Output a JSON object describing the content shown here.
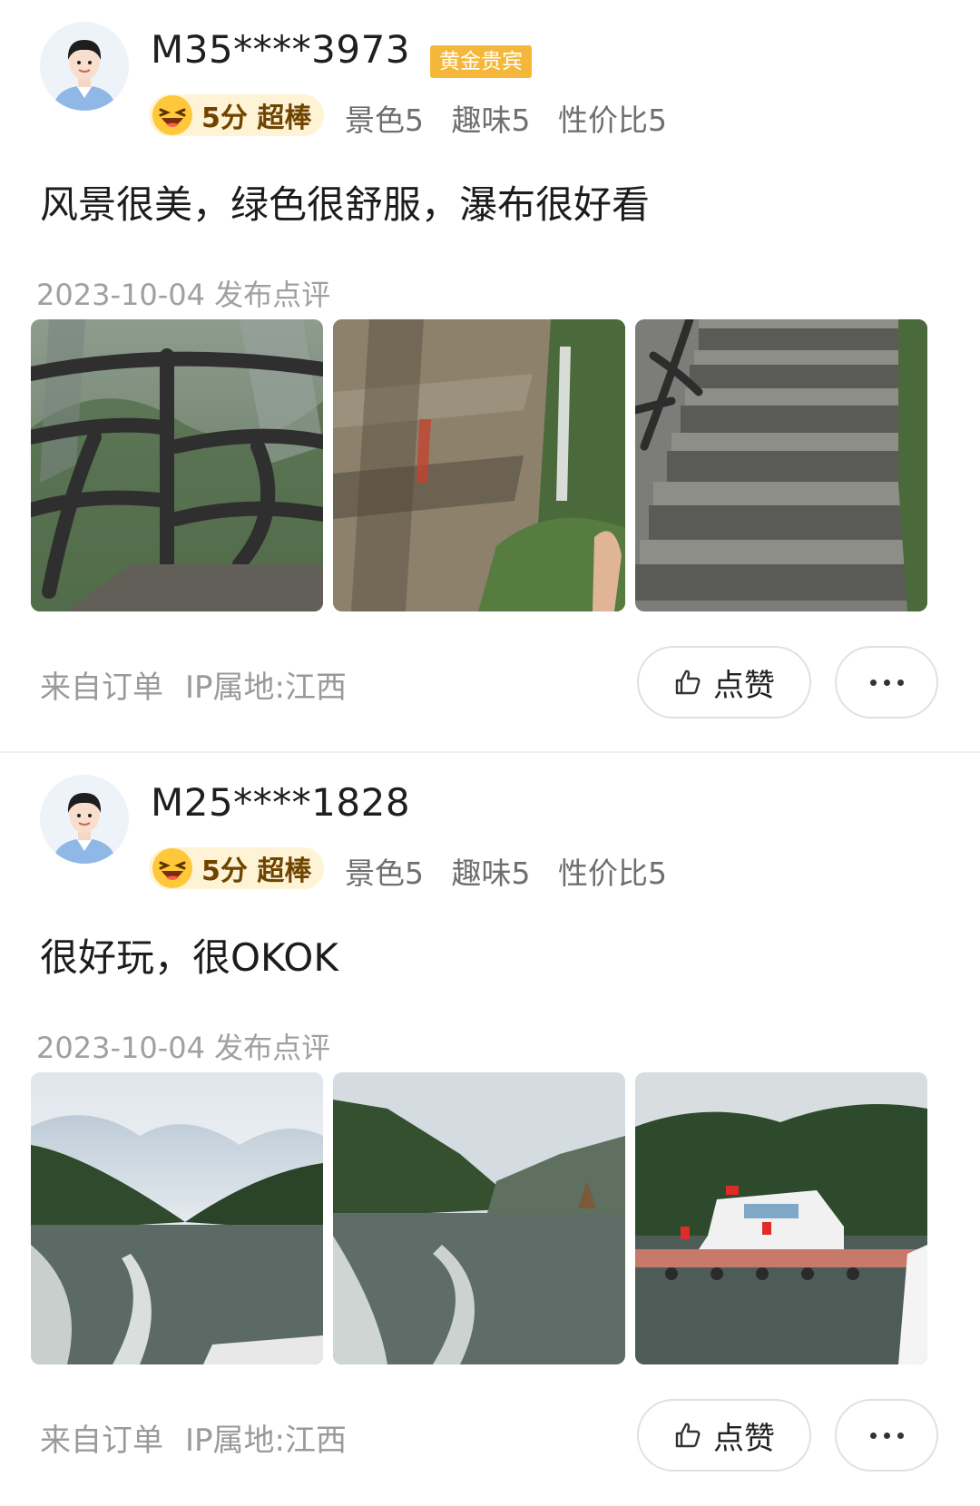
{
  "reviews": [
    {
      "username": "M35****3973",
      "badge": "黄金贵宾",
      "score_label": "5分 超棒",
      "sub_scores": [
        "景色5",
        "趣味5",
        "性价比5"
      ],
      "content": "风景很美，绿色很舒服，瀑布很好看",
      "date_line": "2023-10-04 发布点评",
      "photos": [
        "wooden-railing-cliff-photo",
        "rock-cliff-waterfall-photo",
        "stone-steps-photo"
      ],
      "source": "来自订单",
      "ip": "IP属地:江西",
      "like_label": "点赞"
    },
    {
      "username": "M25****1828",
      "score_label": "5分 超棒",
      "sub_scores": [
        "景色5",
        "趣味5",
        "性价比5"
      ],
      "content": "很好玩，很OKOK",
      "date_line": "2023-10-04 发布点评",
      "photos": [
        "lake-boat-wake-photo",
        "lake-mountains-wake-photo",
        "pier-boat-flags-photo"
      ],
      "source": "来自订单",
      "ip": "IP属地:江西",
      "like_label": "点赞"
    }
  ],
  "colors": {
    "badge": "#f5b73a",
    "pill_bg": "#fff3d6",
    "pill_text": "#6e4400",
    "meta": "#9a9a9a"
  }
}
